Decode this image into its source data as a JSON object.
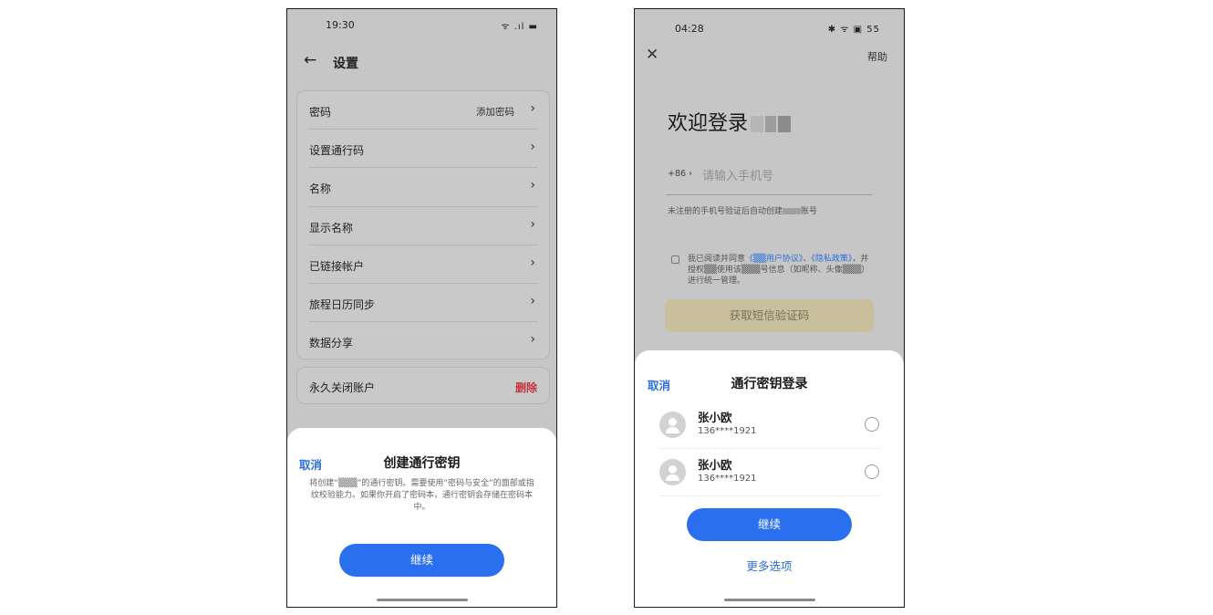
{
  "left_screen": {
    "status": {
      "time": "19:30",
      "icons": "ᯤ .ıl ▬"
    },
    "nav": {
      "back_icon": "←",
      "title": "设置"
    },
    "settings": [
      {
        "label": "密码",
        "value": "添加密码",
        "chevron": "›"
      },
      {
        "label": "设置通行码",
        "value": "",
        "chevron": "›"
      },
      {
        "label": "名称",
        "value": "",
        "chevron": "›"
      },
      {
        "label": "显示名称",
        "value": "",
        "chevron": "›"
      },
      {
        "label": "已链接帐户",
        "value": "",
        "chevron": "›"
      },
      {
        "label": "旅程日历同步",
        "value": "",
        "chevron": "›"
      },
      {
        "label": "数据分享",
        "value": "",
        "chevron": "›"
      }
    ],
    "close_account": {
      "label": "永久关闭账户",
      "action": "删除"
    },
    "sheet": {
      "cancel": "取消",
      "title": "创建通行密钥",
      "description": "将创建“▒▒▒”的通行密钥。需要使用“密码与安全”的面部或指纹校验能力。如果你开启了密码本，通行密钥会存储在密码本中。",
      "continue": "继续"
    }
  },
  "right_screen": {
    "status": {
      "time": "04:28",
      "icons": "✱ ᯤ ▣ 55"
    },
    "close_icon": "✕",
    "help": "帮助",
    "welcome": "欢迎登录",
    "country_code": "+86 ›",
    "phone_placeholder": "请输入手机号",
    "hint_prefix": "未注册的手机号验证后自动创建",
    "hint_suffix": "账号",
    "agreement": {
      "text1": "我已阅读并同意",
      "user_agreement": "《▒▒用户协议》",
      "sep": "、",
      "privacy": "《隐私政策》",
      "text2": "，并授权▒▒使用该▒▒▒号信息（如昵称、头像▒▒▒）进行统一管理。"
    },
    "sms_button": "获取短信验证码",
    "sheet": {
      "cancel": "取消",
      "title": "通行密钥登录",
      "accounts": [
        {
          "name": "张小欧",
          "phone": "136****1921"
        },
        {
          "name": "张小欧",
          "phone": "136****1921"
        }
      ],
      "continue": "继续",
      "more_options": "更多选项"
    }
  }
}
